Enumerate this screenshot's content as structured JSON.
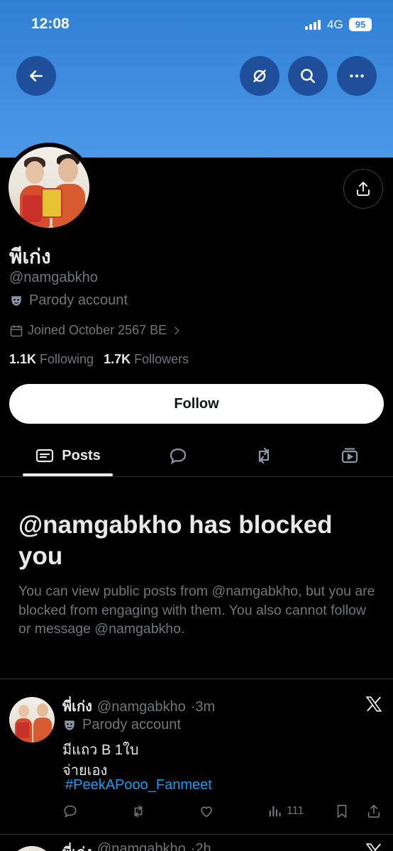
{
  "status_bar": {
    "time": "12:08",
    "network": "4G",
    "battery": "95"
  },
  "profile": {
    "display_name": "พีเก่ง",
    "handle": "@namgabkho",
    "parody_label": "Parody account",
    "joined": "Joined October 2567 BE",
    "following_count": "1.1K",
    "following_label": "Following",
    "followers_count": "1.7K",
    "followers_label": "Followers"
  },
  "follow_button": {
    "label": "Follow"
  },
  "tabs": [
    {
      "label": "Posts",
      "icon": "posts-icon",
      "active": true
    },
    {
      "label": "",
      "icon": "replies-icon",
      "active": false
    },
    {
      "label": "",
      "icon": "repost-icon",
      "active": false
    },
    {
      "label": "",
      "icon": "media-icon",
      "active": false
    }
  ],
  "blocked": {
    "title": "@namgabkho has blocked you",
    "message": "You can view public posts from @namgabkho, but you are blocked from engaging with them. You also cannot follow or message @namgabkho."
  },
  "post": {
    "author": "พี่เก่ง",
    "handle": "@namgabkho",
    "time": "·3m",
    "parody_label": "Parody account",
    "line1": "มีแถว B 1ใบ",
    "line2": "จ่ายเอง",
    "hashtag": "#PeekAPooo_Fanmeet",
    "views": "111"
  },
  "next_post": {
    "author": "พี่เก่ง",
    "handle": "@namgabkho",
    "time": "·2h"
  },
  "colors": {
    "banner": "#3a8ee0",
    "accent": "#1d9bf0",
    "muted": "#71767b",
    "text": "#e7e9ea"
  }
}
